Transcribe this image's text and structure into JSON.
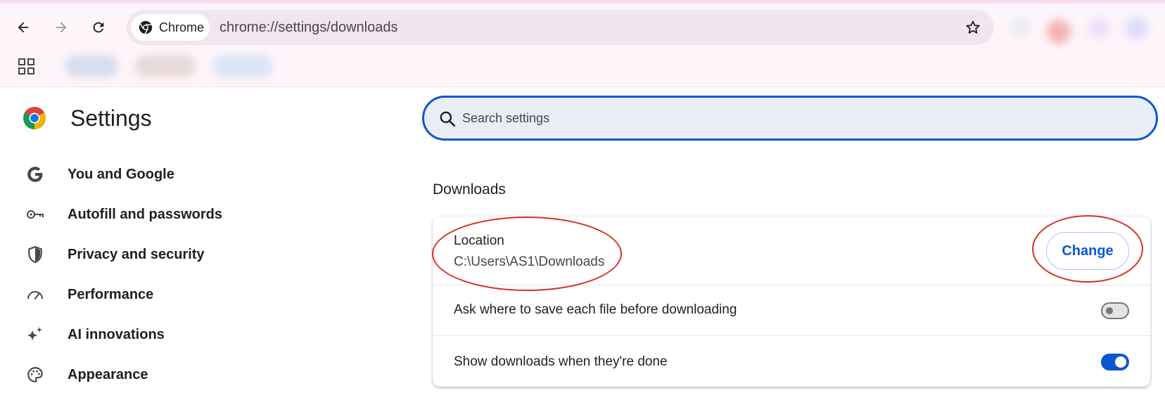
{
  "browser": {
    "chip_label": "Chrome",
    "url": "chrome://settings/downloads",
    "icons": [
      "back-arrow-icon",
      "forward-arrow-icon",
      "reload-icon",
      "chrome-logo-icon",
      "star-bookmark-icon",
      "apps-grid-icon"
    ]
  },
  "sidebar": {
    "title": "Settings",
    "items": [
      {
        "label": "You and Google",
        "icon": "google-g-icon"
      },
      {
        "label": "Autofill and passwords",
        "icon": "key-icon"
      },
      {
        "label": "Privacy and security",
        "icon": "shield-icon"
      },
      {
        "label": "Performance",
        "icon": "speedometer-icon"
      },
      {
        "label": "AI innovations",
        "icon": "sparkle-icon"
      },
      {
        "label": "Appearance",
        "icon": "palette-icon"
      }
    ]
  },
  "search": {
    "placeholder": "Search settings"
  },
  "downloads": {
    "section_title": "Downloads",
    "location_label": "Location",
    "location_path": "C:\\Users\\AS1\\Downloads",
    "change_label": "Change",
    "ask_label": "Ask where to save each file before downloading",
    "ask_enabled": false,
    "show_label": "Show downloads when they're done",
    "show_enabled": true
  },
  "colors": {
    "accent": "#0b57d0",
    "annotation": "#d93025",
    "topbar_bg": "#fdf5fa",
    "search_bg": "#e9eef6"
  }
}
